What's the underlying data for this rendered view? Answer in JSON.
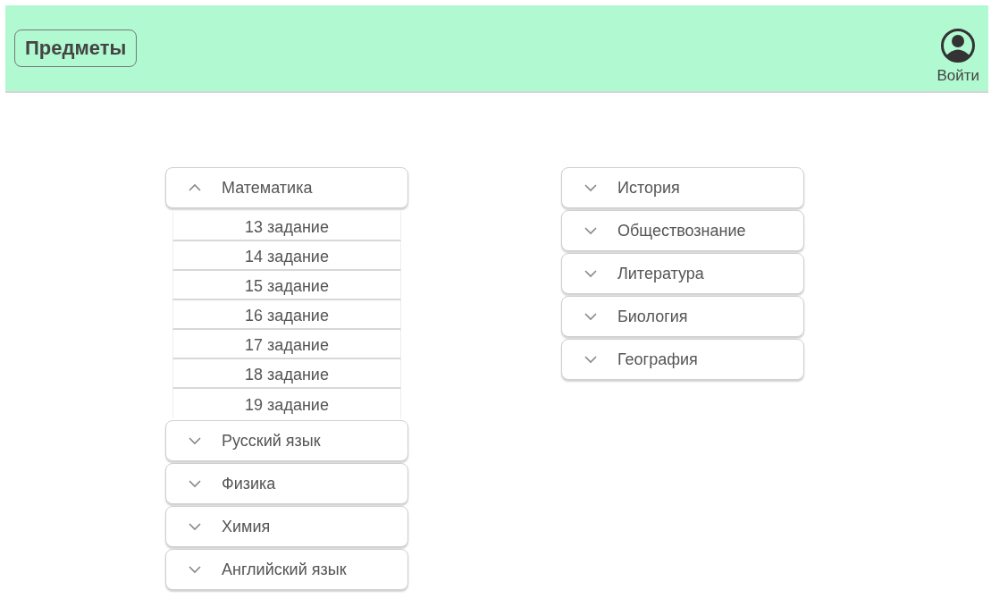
{
  "header": {
    "title": "Предметы",
    "login": "Войти"
  },
  "columns": [
    {
      "subjects": [
        {
          "label": "Математика",
          "expanded": true,
          "tasks": [
            "13 задание",
            "14 задание",
            "15 задание",
            "16 задание",
            "17 задание",
            "18 задание",
            "19 задание"
          ]
        },
        {
          "label": "Русский язык",
          "expanded": false
        },
        {
          "label": "Физика",
          "expanded": false
        },
        {
          "label": "Химия",
          "expanded": false
        },
        {
          "label": "Английский язык",
          "expanded": false
        }
      ]
    },
    {
      "subjects": [
        {
          "label": "История",
          "expanded": false
        },
        {
          "label": "Обществознание",
          "expanded": false
        },
        {
          "label": "Литература",
          "expanded": false
        },
        {
          "label": "Биология",
          "expanded": false
        },
        {
          "label": "География",
          "expanded": false
        }
      ]
    }
  ]
}
